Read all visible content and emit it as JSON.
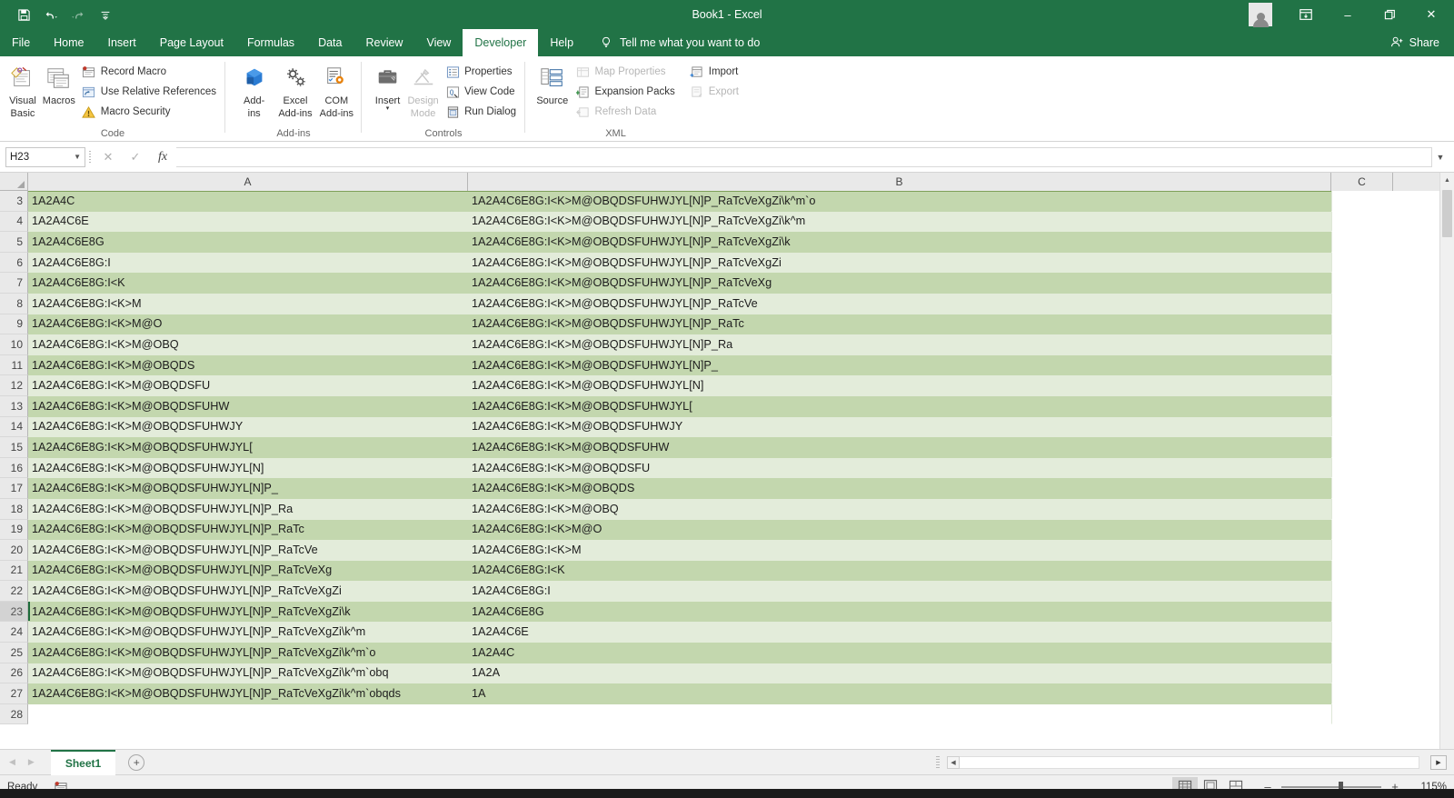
{
  "window": {
    "title": "Book1  -  Excel",
    "quick_access": [
      "save-icon",
      "undo-icon",
      "redo-icon",
      "customize-qat-icon"
    ],
    "controls": {
      "minimize": "–",
      "restore": "❐",
      "close": "✕"
    },
    "ribbon_display_icon": "ribbon-display-options-icon",
    "share_label": "Share"
  },
  "tabs": {
    "items": [
      "File",
      "Home",
      "Insert",
      "Page Layout",
      "Formulas",
      "Data",
      "Review",
      "View",
      "Developer",
      "Help"
    ],
    "active": "Developer",
    "tell_me": "Tell me what you want to do"
  },
  "ribbon": {
    "groups": [
      {
        "name": "Code",
        "label": "Code",
        "big_buttons": [
          {
            "label_line1": "Visual",
            "label_line2": "Basic",
            "icon": "visual-basic-icon",
            "disabled": false
          },
          {
            "label_line1": "Macros",
            "label_line2": "",
            "icon": "macros-icon",
            "disabled": false
          }
        ],
        "small_buttons": [
          {
            "label": "Record Macro",
            "icon": "record-macro-icon",
            "disabled": false
          },
          {
            "label": "Use Relative References",
            "icon": "relative-references-icon",
            "disabled": false
          },
          {
            "label": "Macro Security",
            "icon": "macro-security-icon",
            "disabled": false
          }
        ]
      },
      {
        "name": "Add-ins",
        "label": "Add-ins",
        "big_buttons": [
          {
            "label_line1": "Add-",
            "label_line2": "ins",
            "icon": "add-ins-icon",
            "disabled": false
          },
          {
            "label_line1": "Excel",
            "label_line2": "Add-ins",
            "icon": "excel-add-ins-icon",
            "disabled": false
          },
          {
            "label_line1": "COM",
            "label_line2": "Add-ins",
            "icon": "com-add-ins-icon",
            "disabled": false
          }
        ],
        "small_buttons": []
      },
      {
        "name": "Controls",
        "label": "Controls",
        "big_buttons": [
          {
            "label_line1": "Insert",
            "label_line2": "",
            "icon": "insert-control-icon",
            "disabled": false,
            "caret": true
          },
          {
            "label_line1": "Design",
            "label_line2": "Mode",
            "icon": "design-mode-icon",
            "disabled": true
          }
        ],
        "small_buttons": [
          {
            "label": "Properties",
            "icon": "properties-icon",
            "disabled": false
          },
          {
            "label": "View Code",
            "icon": "view-code-icon",
            "disabled": false
          },
          {
            "label": "Run Dialog",
            "icon": "run-dialog-icon",
            "disabled": false
          }
        ]
      },
      {
        "name": "XML",
        "label": "XML",
        "big_buttons": [
          {
            "label_line1": "Source",
            "label_line2": "",
            "icon": "xml-source-icon",
            "disabled": false
          }
        ],
        "small_buttons": [
          {
            "label": "Map Properties",
            "icon": "map-properties-icon",
            "disabled": true
          },
          {
            "label": "Expansion Packs",
            "icon": "expansion-packs-icon",
            "disabled": false
          },
          {
            "label": "Refresh Data",
            "icon": "refresh-data-icon",
            "disabled": true
          }
        ],
        "small_buttons2": [
          {
            "label": "Import",
            "icon": "import-icon",
            "disabled": false
          },
          {
            "label": "Export",
            "icon": "export-icon",
            "disabled": true
          }
        ]
      }
    ]
  },
  "formula_bar": {
    "name_box": "H23",
    "cancel_icon": "cancel-icon",
    "enter_icon": "confirm-icon",
    "function_icon": "insert-function-icon",
    "value": "",
    "expand_icon": "expand-formula-bar-icon"
  },
  "grid": {
    "columns": [
      "A",
      "B",
      "C"
    ],
    "selected_cell": "H23",
    "selected_row": 23,
    "first_visible_row": 3,
    "rows": [
      {
        "n": 3,
        "a": "1A2A4C",
        "b": "1A2A4C6E8G:I<K>M@OBQDSFUHWJYL[N]P_RaTcVeXgZi\\k^m`o"
      },
      {
        "n": 4,
        "a": "1A2A4C6E",
        "b": "1A2A4C6E8G:I<K>M@OBQDSFUHWJYL[N]P_RaTcVeXgZi\\k^m"
      },
      {
        "n": 5,
        "a": "1A2A4C6E8G",
        "b": "1A2A4C6E8G:I<K>M@OBQDSFUHWJYL[N]P_RaTcVeXgZi\\k"
      },
      {
        "n": 6,
        "a": "1A2A4C6E8G:I",
        "b": "1A2A4C6E8G:I<K>M@OBQDSFUHWJYL[N]P_RaTcVeXgZi"
      },
      {
        "n": 7,
        "a": "1A2A4C6E8G:I<K",
        "b": "1A2A4C6E8G:I<K>M@OBQDSFUHWJYL[N]P_RaTcVeXg"
      },
      {
        "n": 8,
        "a": "1A2A4C6E8G:I<K>M",
        "b": "1A2A4C6E8G:I<K>M@OBQDSFUHWJYL[N]P_RaTcVe"
      },
      {
        "n": 9,
        "a": "1A2A4C6E8G:I<K>M@O",
        "b": "1A2A4C6E8G:I<K>M@OBQDSFUHWJYL[N]P_RaTc"
      },
      {
        "n": 10,
        "a": "1A2A4C6E8G:I<K>M@OBQ",
        "b": "1A2A4C6E8G:I<K>M@OBQDSFUHWJYL[N]P_Ra"
      },
      {
        "n": 11,
        "a": "1A2A4C6E8G:I<K>M@OBQDS",
        "b": "1A2A4C6E8G:I<K>M@OBQDSFUHWJYL[N]P_"
      },
      {
        "n": 12,
        "a": "1A2A4C6E8G:I<K>M@OBQDSFU",
        "b": "1A2A4C6E8G:I<K>M@OBQDSFUHWJYL[N]"
      },
      {
        "n": 13,
        "a": "1A2A4C6E8G:I<K>M@OBQDSFUHW",
        "b": "1A2A4C6E8G:I<K>M@OBQDSFUHWJYL["
      },
      {
        "n": 14,
        "a": "1A2A4C6E8G:I<K>M@OBQDSFUHWJY",
        "b": "1A2A4C6E8G:I<K>M@OBQDSFUHWJY"
      },
      {
        "n": 15,
        "a": "1A2A4C6E8G:I<K>M@OBQDSFUHWJYL[",
        "b": "1A2A4C6E8G:I<K>M@OBQDSFUHW"
      },
      {
        "n": 16,
        "a": "1A2A4C6E8G:I<K>M@OBQDSFUHWJYL[N]",
        "b": "1A2A4C6E8G:I<K>M@OBQDSFU"
      },
      {
        "n": 17,
        "a": "1A2A4C6E8G:I<K>M@OBQDSFUHWJYL[N]P_",
        "b": "1A2A4C6E8G:I<K>M@OBQDS"
      },
      {
        "n": 18,
        "a": "1A2A4C6E8G:I<K>M@OBQDSFUHWJYL[N]P_Ra",
        "b": "1A2A4C6E8G:I<K>M@OBQ"
      },
      {
        "n": 19,
        "a": "1A2A4C6E8G:I<K>M@OBQDSFUHWJYL[N]P_RaTc",
        "b": "1A2A4C6E8G:I<K>M@O"
      },
      {
        "n": 20,
        "a": "1A2A4C6E8G:I<K>M@OBQDSFUHWJYL[N]P_RaTcVe",
        "b": "1A2A4C6E8G:I<K>M"
      },
      {
        "n": 21,
        "a": "1A2A4C6E8G:I<K>M@OBQDSFUHWJYL[N]P_RaTcVeXg",
        "b": "1A2A4C6E8G:I<K"
      },
      {
        "n": 22,
        "a": "1A2A4C6E8G:I<K>M@OBQDSFUHWJYL[N]P_RaTcVeXgZi",
        "b": "1A2A4C6E8G:I"
      },
      {
        "n": 23,
        "a": "1A2A4C6E8G:I<K>M@OBQDSFUHWJYL[N]P_RaTcVeXgZi\\k",
        "b": "1A2A4C6E8G"
      },
      {
        "n": 24,
        "a": "1A2A4C6E8G:I<K>M@OBQDSFUHWJYL[N]P_RaTcVeXgZi\\k^m",
        "b": "1A2A4C6E"
      },
      {
        "n": 25,
        "a": "1A2A4C6E8G:I<K>M@OBQDSFUHWJYL[N]P_RaTcVeXgZi\\k^m`o",
        "b": "1A2A4C"
      },
      {
        "n": 26,
        "a": "1A2A4C6E8G:I<K>M@OBQDSFUHWJYL[N]P_RaTcVeXgZi\\k^m`obq",
        "b": "1A2A"
      },
      {
        "n": 27,
        "a": "1A2A4C6E8G:I<K>M@OBQDSFUHWJYL[N]P_RaTcVeXgZi\\k^m`obqds",
        "b": "1A"
      },
      {
        "n": 28,
        "a": "",
        "b": ""
      }
    ]
  },
  "sheet_tabs": {
    "items": [
      "Sheet1"
    ],
    "active": "Sheet1",
    "add_label": "+",
    "prev_icon": "prev-sheet-icon",
    "next_icon": "next-sheet-icon"
  },
  "status_bar": {
    "state": "Ready",
    "macro_record_icon": "record-macro-status-icon",
    "views": [
      {
        "name": "normal-view",
        "icon": "grid-view-icon",
        "active": true
      },
      {
        "name": "page-layout-view",
        "icon": "page-layout-icon",
        "active": false
      },
      {
        "name": "page-break-view",
        "icon": "page-break-icon",
        "active": false
      }
    ],
    "zoom_out": "–",
    "zoom_in": "+",
    "zoom_level": "115%"
  },
  "colors": {
    "brand_green": "#217346",
    "band_dark": "#c3d7ae",
    "band_light": "#e3ecda",
    "header_gray": "#e9e9e9"
  }
}
